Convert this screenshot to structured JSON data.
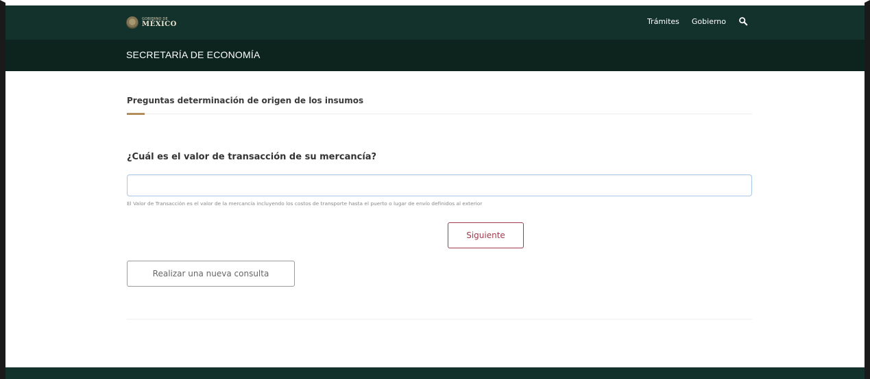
{
  "header": {
    "logo_small": "GOBIERNO DE",
    "logo_big": "MÉXICO",
    "nav": [
      {
        "label": "Trámites"
      },
      {
        "label": "Gobierno"
      }
    ],
    "subtitle": "SECRETARÍA DE ECONOMÍA",
    "icons": {
      "search": "search-icon"
    }
  },
  "main": {
    "section_title": "Preguntas determinación de origen de los insumos",
    "question": "¿Cuál es el valor de transacción de su mercancía?",
    "input": {
      "value": "",
      "placeholder": ""
    },
    "help_text": "El Valor de Transacción es el valor de la mercancía incluyendo los costos de transporte hasta el puerto o lugar de envío definidos al exterior",
    "next_button": "Siguiente",
    "new_query_button": "Realizar una nueva consulta"
  },
  "colors": {
    "header_bg": "#13322b",
    "subheader_bg": "#0c231e",
    "accent_gold": "#b38e5d",
    "next_button": "#a03a4e"
  }
}
